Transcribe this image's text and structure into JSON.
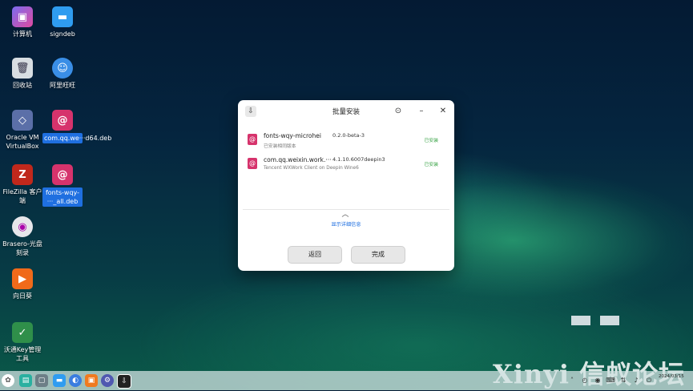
{
  "desktop": {
    "icons": [
      {
        "label": "计算机"
      },
      {
        "label": "signdeb"
      },
      {
        "label": "回收站"
      },
      {
        "label": "阿里旺旺"
      },
      {
        "label": "Oracle VM VirtualBox"
      },
      {
        "label": "com.qq.we···d64.deb"
      },
      {
        "label": "FileZilla 客户端"
      },
      {
        "label": "fonts-wqy-···_all.deb"
      },
      {
        "label": "Brasero-光盘刻录"
      },
      {
        "label": "向日葵"
      },
      {
        "label": "沃通Key管理工具"
      }
    ]
  },
  "window": {
    "title": "批量安装",
    "packages": [
      {
        "name": "fonts-wqy-microhei",
        "version": "0.2.0-beta-3",
        "description": "已安装相同版本",
        "status": "已安装"
      },
      {
        "name": "com.qq.weixin.work.···",
        "version": "4.1.10.6007deepin3",
        "description": "Tencent WXWork Client on Deepin Wine6",
        "status": "已安装"
      }
    ],
    "details_link": "显示详细信息",
    "back_button": "返回",
    "done_button": "完成"
  },
  "watermark": "Xinyi 信蚁论坛",
  "clock": {
    "date": "2024/03/15"
  },
  "colors": {
    "accent": "#1f6fe0",
    "installed": "#2e9e3b",
    "package_icon": "#d6336c"
  }
}
